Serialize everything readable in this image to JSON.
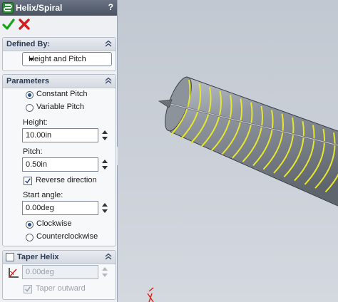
{
  "window": {
    "title": "Helix/Spiral",
    "help_label": "?"
  },
  "actions": {
    "ok_icon": "checkmark-icon",
    "cancel_icon": "x-icon"
  },
  "defined_by": {
    "title": "Defined By:",
    "selected": "Height and Pitch"
  },
  "parameters": {
    "title": "Parameters",
    "pitch_mode": {
      "options": [
        "Constant Pitch",
        "Variable Pitch"
      ],
      "selected_index": 0
    },
    "height": {
      "label": "Height:",
      "value": "10.00in"
    },
    "pitch": {
      "label": "Pitch:",
      "value": "0.50in"
    },
    "reverse_direction": {
      "label": "Reverse direction",
      "checked": true
    },
    "start_angle": {
      "label": "Start angle:",
      "value": "0.00deg"
    },
    "rotation": {
      "options": [
        "Clockwise",
        "Counterclockwise"
      ],
      "selected_index": 0
    }
  },
  "taper": {
    "title": "Taper Helix",
    "enabled": false,
    "angle": {
      "value": "0.00deg"
    },
    "taper_outward": {
      "label": "Taper outward",
      "checked": true
    }
  },
  "colors": {
    "helix": "#e6e62e",
    "cylinder": "#7f858e",
    "accent": "#1f4f9a"
  }
}
